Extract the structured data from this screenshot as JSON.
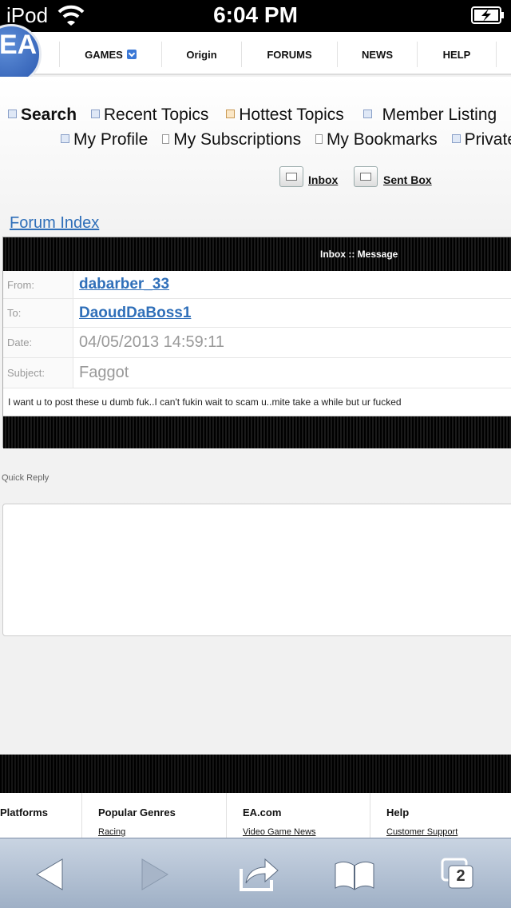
{
  "status_bar": {
    "carrier": "iPod",
    "time": "6:04 PM"
  },
  "top_nav": {
    "logo": "EA",
    "items": [
      {
        "label": "GAMES"
      },
      {
        "label": "Origin"
      },
      {
        "label": "FORUMS"
      },
      {
        "label": "NEWS"
      },
      {
        "label": "HELP"
      }
    ]
  },
  "forum_links": {
    "search": "Search",
    "recent_topics": "Recent Topics",
    "hottest_topics": "Hottest Topics",
    "member_listing": "Member Listing",
    "my_profile": "My Profile",
    "my_subscriptions": "My Subscriptions",
    "my_bookmarks": "My Bookmarks",
    "private": "Private"
  },
  "mailbox": {
    "inbox": "Inbox",
    "sent_box": "Sent Box"
  },
  "breadcrumb": {
    "forum_index": "Forum Index"
  },
  "message": {
    "header": "Inbox :: Message",
    "from_label": "From:",
    "from": "dabarber_33",
    "to_label": "To:",
    "to": "DaoudDaBoss1",
    "date_label": "Date:",
    "date": "04/05/2013 14:59:11",
    "subject_label": "Subject:",
    "subject": "Faggot",
    "body": "I want u to post these u dumb fuk..I can't fukin wait to scam u..mite take a while but ur fucked"
  },
  "quick_reply": {
    "label": "Quick Reply"
  },
  "footer": {
    "columns": [
      {
        "heading": "Platforms",
        "link": ""
      },
      {
        "heading": "Popular Genres",
        "link": "Racing"
      },
      {
        "heading": "EA.com",
        "link": "Video Game News"
      },
      {
        "heading": "Help",
        "link": "Customer Support"
      }
    ]
  },
  "browser": {
    "tab_count": "2"
  }
}
